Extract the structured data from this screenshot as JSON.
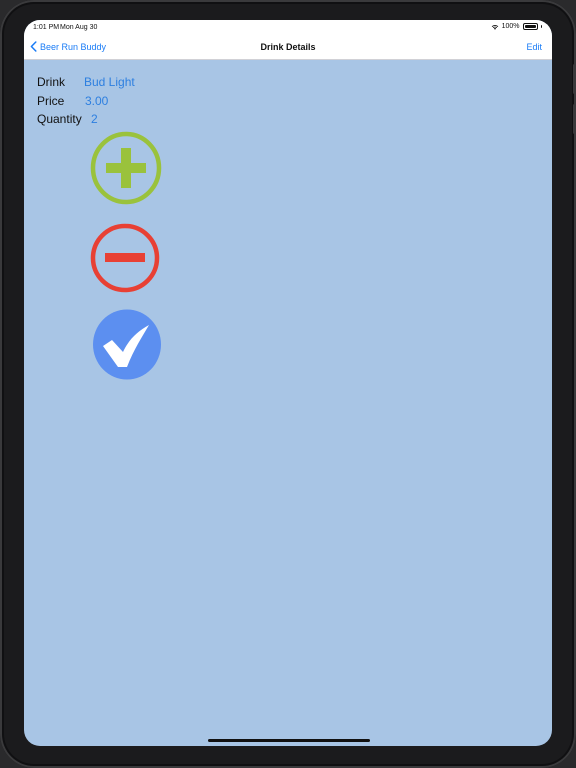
{
  "status_bar": {
    "time": "1:01 PM",
    "date": "Mon Aug 30",
    "battery": "100%"
  },
  "nav": {
    "back_label": "Beer Run Buddy",
    "title": "Drink Details",
    "edit_label": "Edit"
  },
  "details": {
    "drink_label": "Drink",
    "drink_value": "Bud Light",
    "price_label": "Price",
    "price_value": "3.00",
    "quantity_label": "Quantity",
    "quantity_value": "2"
  },
  "colors": {
    "screen_background": "#a8c5e5",
    "accent": "#1a7cf6",
    "add_green": "#9ac23c",
    "remove_red": "#e84034",
    "confirm_blue": "#5c8ff0"
  },
  "icons": {
    "add": "plus-circle-icon",
    "remove": "minus-circle-icon",
    "confirm": "checkmark-circle-icon",
    "back": "chevron-left-icon"
  }
}
